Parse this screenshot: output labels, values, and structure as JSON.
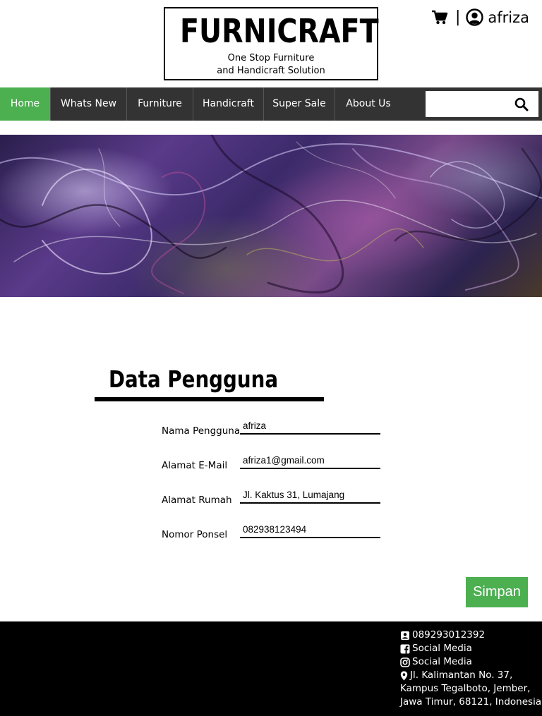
{
  "brand": {
    "title": "FURNICRAFT",
    "tagline_line1": "One Stop Furniture",
    "tagline_line2": "and Handicraft Solution"
  },
  "user_bar": {
    "separator": "|",
    "username": "afriza"
  },
  "nav": {
    "items": [
      {
        "label": "Home",
        "active": true
      },
      {
        "label": "Whats New",
        "active": false
      },
      {
        "label": "Furniture",
        "active": false
      },
      {
        "label": "Handicraft",
        "active": false
      },
      {
        "label": "Super Sale",
        "active": false
      },
      {
        "label": "About Us",
        "active": false
      }
    ],
    "search": {
      "value": "",
      "placeholder": ""
    }
  },
  "page": {
    "title": "Data Pengguna"
  },
  "form": {
    "username_label": "Nama Pengguna",
    "username_value": "afriza",
    "email_label": "Alamat E-Mail",
    "email_value": "afriza1@gmail.com",
    "address_label": "Alamat Rumah",
    "address_value": "Jl. Kaktus 31, Lumajang",
    "phone_label": "Nomor Ponsel",
    "phone_value": "082938123494",
    "save_label": "Simpan"
  },
  "footer": {
    "phone": "089293012392",
    "facebook": "Social Media",
    "instagram": "Social Media",
    "address_line1": "Jl. Kalimantan No. 37,",
    "address_line2": "Kampus Tegalboto, Jember,",
    "address_line3": "Jawa Timur, 68121, Indonesia"
  },
  "colors": {
    "accent": "#4caf50",
    "nav_bg": "#333333",
    "footer_bg": "#000000"
  },
  "icons": {
    "cart": "cart-icon",
    "user": "user-circle-icon",
    "search": "search-icon",
    "phone": "contact-phone-icon",
    "facebook": "facebook-icon",
    "instagram": "instagram-icon",
    "location": "map-marker-icon"
  }
}
